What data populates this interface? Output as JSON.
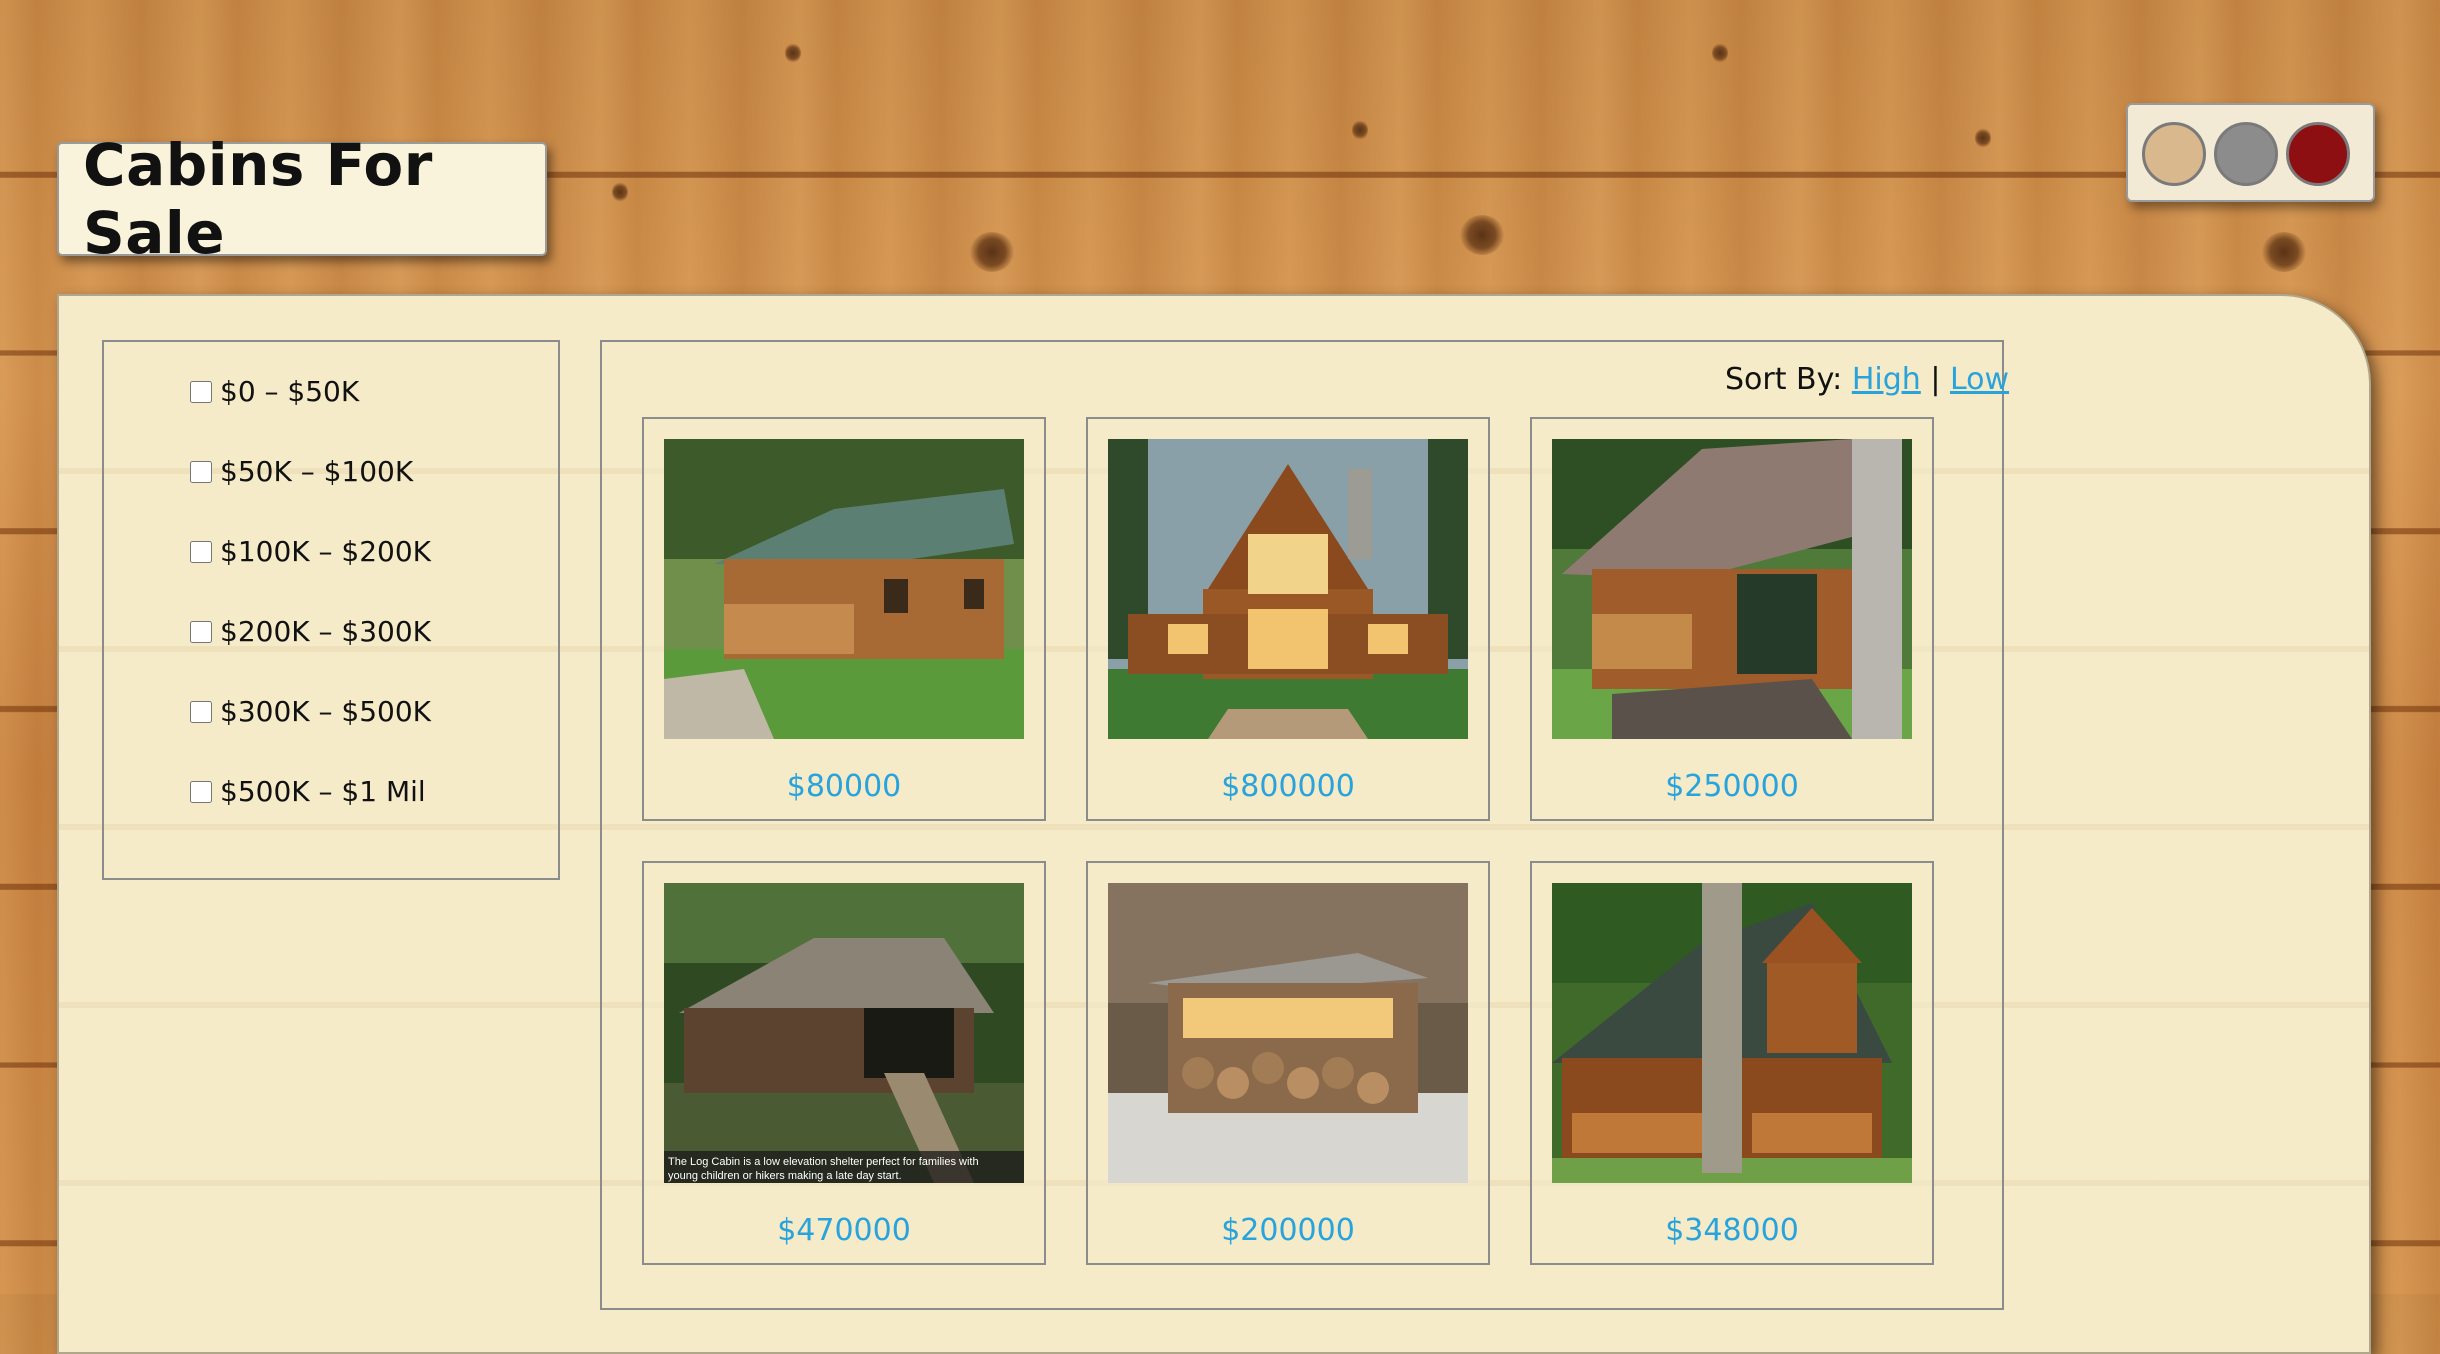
{
  "page": {
    "title": "Cabins For Sale"
  },
  "theme_swatches": [
    {
      "name": "tan",
      "color": "#d8b88c"
    },
    {
      "name": "gray",
      "color": "#8c8c8c"
    },
    {
      "name": "red",
      "color": "#8e0f12"
    }
  ],
  "filters": [
    {
      "label": "$0 – $50K",
      "checked": false
    },
    {
      "label": "$50K – $100K",
      "checked": false
    },
    {
      "label": "$100K – $200K",
      "checked": false
    },
    {
      "label": "$200K – $300K",
      "checked": false
    },
    {
      "label": "$300K – $500K",
      "checked": false
    },
    {
      "label": "$500K – $1 Mil",
      "checked": false
    }
  ],
  "sort": {
    "label": "Sort By: ",
    "high": "High",
    "separator": " | ",
    "low": "Low"
  },
  "listings": [
    {
      "price": "$80000",
      "image": "cabin-green-roof-icon"
    },
    {
      "price": "$800000",
      "image": "lodge-large-icon"
    },
    {
      "price": "$250000",
      "image": "cabin-stone-chimney-icon"
    },
    {
      "price": "$470000",
      "image": "log-cabin-forest-icon",
      "caption": "The Log Cabin is a low elevation shelter perfect for families with young children or hikers making a late day start."
    },
    {
      "price": "$200000",
      "image": "cabin-log-pile-icon"
    },
    {
      "price": "$348000",
      "image": "cabin-a-frame-icon"
    }
  ]
}
